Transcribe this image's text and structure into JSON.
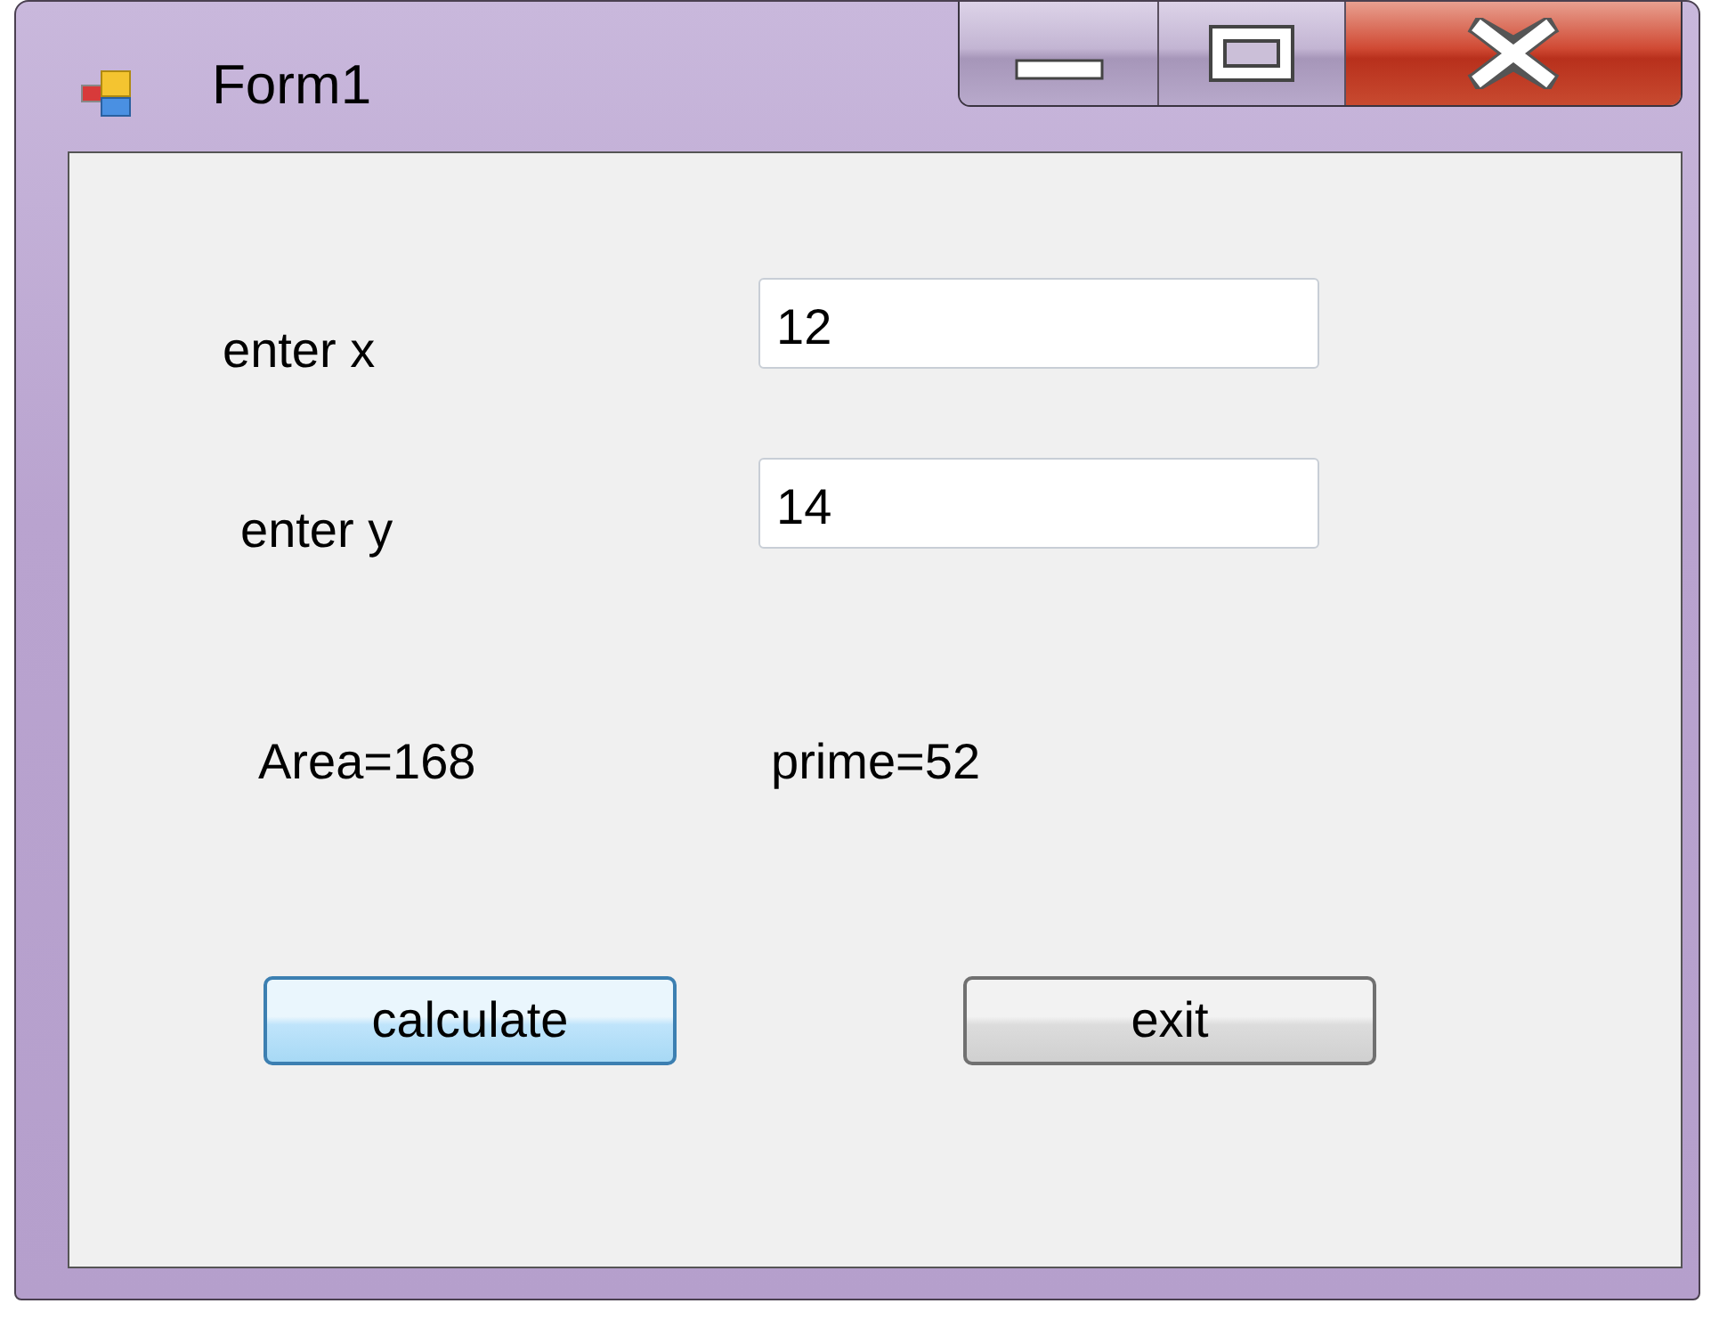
{
  "window": {
    "title": "Form1"
  },
  "fields": [
    {
      "label": "enter x",
      "value": "12"
    },
    {
      "label": "enter y",
      "value": "14"
    }
  ],
  "results": [
    "Area=168",
    "prime=52"
  ],
  "buttons": [
    {
      "label": "calculate",
      "selected": true
    },
    {
      "label": "exit",
      "selected": false
    }
  ]
}
